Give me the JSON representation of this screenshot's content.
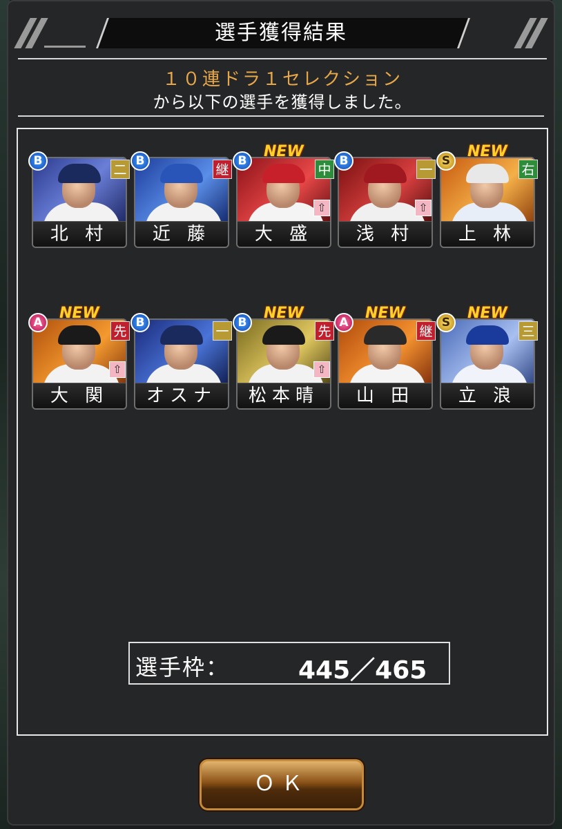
{
  "dialog": {
    "title": "選手獲得結果",
    "subtitle_highlight": "１０連ドラ１セレクション",
    "subtitle_text": "から以下の選手を獲得しました。"
  },
  "players": [
    {
      "name": "北 村",
      "rank": "B",
      "position": "二",
      "position_color": "yellow",
      "new": false,
      "up": false
    },
    {
      "name": "近 藤",
      "rank": "B",
      "position": "継",
      "position_color": "red",
      "new": false,
      "up": false
    },
    {
      "name": "大 盛",
      "rank": "B",
      "position": "中",
      "position_color": "green",
      "new": true,
      "up": true
    },
    {
      "name": "浅 村",
      "rank": "B",
      "position": "一",
      "position_color": "yellow",
      "new": false,
      "up": true
    },
    {
      "name": "上 林",
      "rank": "S",
      "position": "右",
      "position_color": "green",
      "new": true,
      "up": false
    },
    {
      "name": "大 関",
      "rank": "A",
      "position": "先",
      "position_color": "red",
      "new": true,
      "up": true
    },
    {
      "name": "オスナ",
      "rank": "B",
      "position": "一",
      "position_color": "yellow",
      "new": false,
      "up": false
    },
    {
      "name": "松本晴",
      "rank": "B",
      "position": "先",
      "position_color": "red",
      "new": true,
      "up": true
    },
    {
      "name": "山 田",
      "rank": "A",
      "position": "継",
      "position_color": "red",
      "new": true,
      "up": false
    },
    {
      "name": "立 浪",
      "rank": "S",
      "position": "三",
      "position_color": "yellow",
      "new": true,
      "up": false
    }
  ],
  "new_label": "NEW",
  "up_icon_glyph": "⇧",
  "capacity": {
    "label": "選手枠：",
    "value": "445／465"
  },
  "ok_button": {
    "label": "ＯＫ"
  },
  "colors": {
    "accent": "#e8a84a",
    "panel_bg": "#252627"
  }
}
